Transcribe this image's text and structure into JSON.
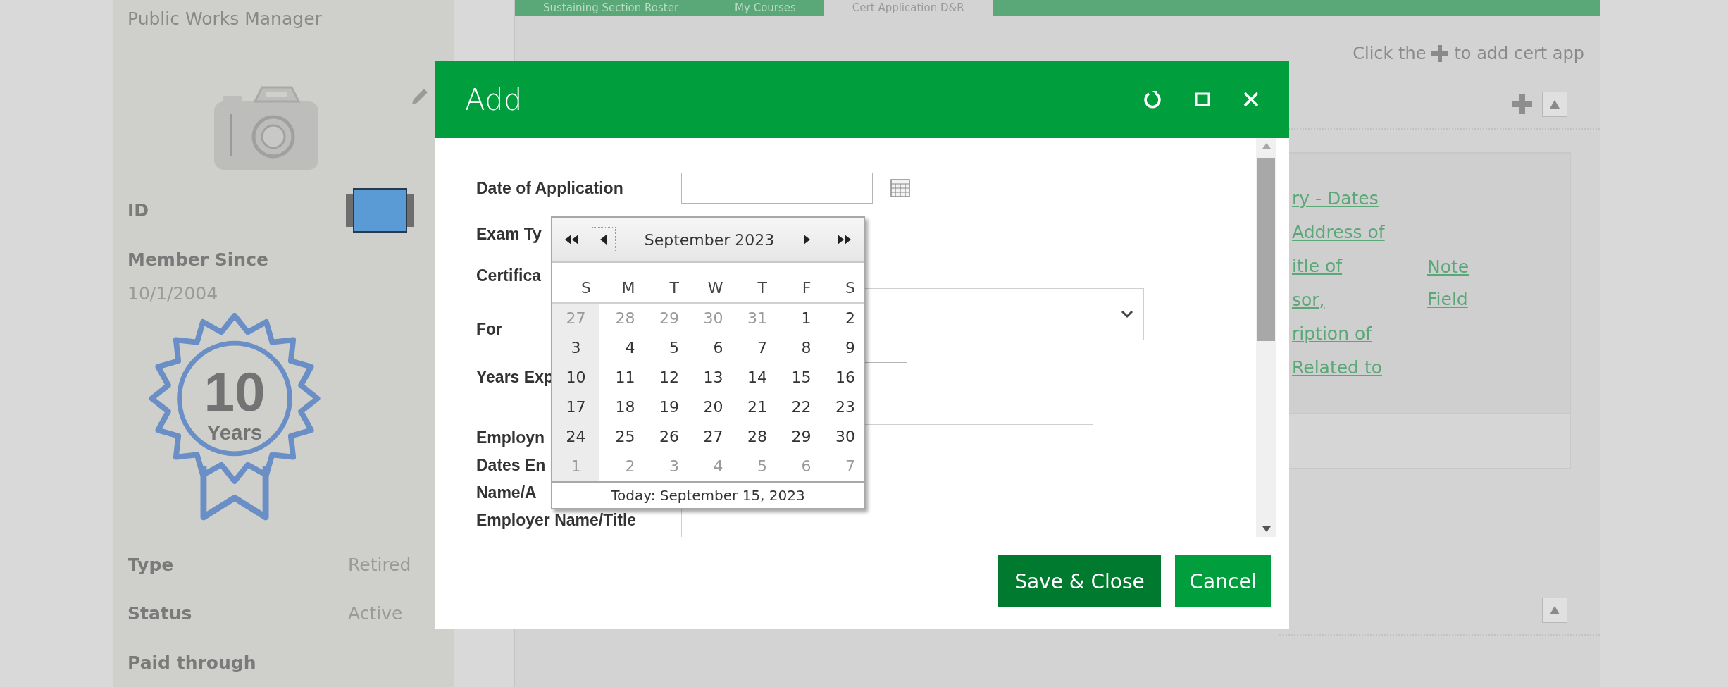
{
  "profile": {
    "job_title": "Public Works Manager",
    "id_label": "ID",
    "member_since_label": "Member Since",
    "member_since": "10/1/2004",
    "badge": {
      "number": "10",
      "label": "Years"
    },
    "details": [
      {
        "label": "Type",
        "value": "Retired"
      },
      {
        "label": "Status",
        "value": "Active"
      },
      {
        "label": "Paid through"
      }
    ]
  },
  "tabs": [
    {
      "label": "Sustaining Section Roster",
      "selected": false
    },
    {
      "label": "My Courses",
      "selected": false
    },
    {
      "label": "Cert Application D&R",
      "selected": true
    }
  ],
  "hint": {
    "before": "Click the",
    "after": "to add cert app"
  },
  "record": {
    "lines": [
      "ry - Dates",
      "Address of",
      "itle of",
      "sor,",
      "ription of",
      "Related to"
    ],
    "note_link": "Note Field"
  },
  "dialog": {
    "title": "Add",
    "fields": [
      {
        "label_lines": [
          "Date of Application"
        ],
        "kind": "date"
      },
      {
        "label_lines": [
          "Exam Ty"
        ],
        "kind": "hidden"
      },
      {
        "label_lines": [
          "Certifica",
          "For"
        ],
        "kind": "select"
      },
      {
        "label_lines": [
          "Years Exp"
        ],
        "kind": "input"
      },
      {
        "label_lines": [
          "Employn",
          "Dates En",
          "Name/A",
          "Employer Name/Title"
        ],
        "kind": "textarea"
      }
    ],
    "calendar": {
      "month": "September 2023",
      "weekdays": [
        "S",
        "M",
        "T",
        "W",
        "T",
        "F",
        "S"
      ],
      "weeks": [
        [
          {
            "day": "27",
            "other_month": true
          },
          {
            "day": "28",
            "other_month": true
          },
          {
            "day": "29",
            "other_month": true
          },
          {
            "day": "30",
            "other_month": true
          },
          {
            "day": "31",
            "other_month": true
          },
          {
            "day": "1",
            "other_month": false
          },
          {
            "day": "2",
            "other_month": false
          }
        ],
        [
          {
            "day": "3",
            "other_month": false
          },
          {
            "day": "4",
            "other_month": false
          },
          {
            "day": "5",
            "other_month": false
          },
          {
            "day": "6",
            "other_month": false
          },
          {
            "day": "7",
            "other_month": false
          },
          {
            "day": "8",
            "other_month": false
          },
          {
            "day": "9",
            "other_month": false
          }
        ],
        [
          {
            "day": "10",
            "other_month": false
          },
          {
            "day": "11",
            "other_month": false
          },
          {
            "day": "12",
            "other_month": false
          },
          {
            "day": "13",
            "other_month": false
          },
          {
            "day": "14",
            "other_month": false
          },
          {
            "day": "15",
            "other_month": false
          },
          {
            "day": "16",
            "other_month": false
          }
        ],
        [
          {
            "day": "17",
            "other_month": false
          },
          {
            "day": "18",
            "other_month": false
          },
          {
            "day": "19",
            "other_month": false
          },
          {
            "day": "20",
            "other_month": false
          },
          {
            "day": "21",
            "other_month": false
          },
          {
            "day": "22",
            "other_month": false
          },
          {
            "day": "23",
            "other_month": false
          }
        ],
        [
          {
            "day": "24",
            "other_month": false
          },
          {
            "day": "25",
            "other_month": false
          },
          {
            "day": "26",
            "other_month": false
          },
          {
            "day": "27",
            "other_month": false
          },
          {
            "day": "28",
            "other_month": false
          },
          {
            "day": "29",
            "other_month": false
          },
          {
            "day": "30",
            "other_month": false
          }
        ],
        [
          {
            "day": "1",
            "other_month": true
          },
          {
            "day": "2",
            "other_month": true
          },
          {
            "day": "3",
            "other_month": true
          },
          {
            "day": "4",
            "other_month": true
          },
          {
            "day": "5",
            "other_month": true
          },
          {
            "day": "6",
            "other_month": true
          },
          {
            "day": "7",
            "other_month": true
          }
        ]
      ],
      "today": "Today: September 15, 2023"
    },
    "buttons": [
      {
        "label": "Save & Close",
        "kind": "primary"
      },
      {
        "label": "Cancel",
        "kind": "secondary"
      }
    ]
  }
}
